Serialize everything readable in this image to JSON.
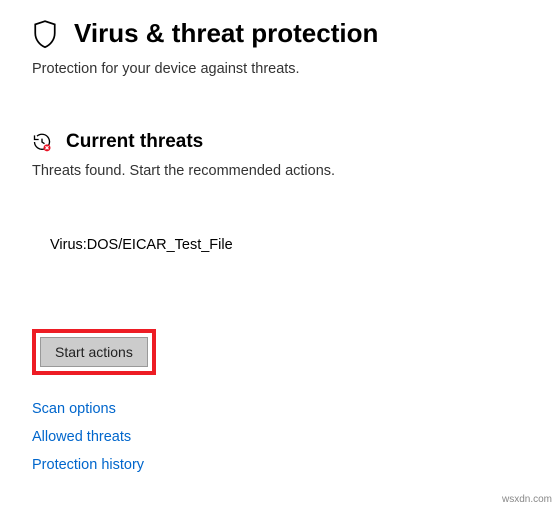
{
  "header": {
    "title": "Virus & threat protection",
    "subtitle": "Protection for your device against threats."
  },
  "section": {
    "title": "Current threats",
    "subtitle": "Threats found. Start the recommended actions."
  },
  "threat": {
    "name": "Virus:DOS/EICAR_Test_File"
  },
  "actions": {
    "start_button": "Start actions"
  },
  "links": {
    "scan_options": "Scan options",
    "allowed_threats": "Allowed threats",
    "protection_history": "Protection history"
  },
  "watermark": "wsxdn.com"
}
